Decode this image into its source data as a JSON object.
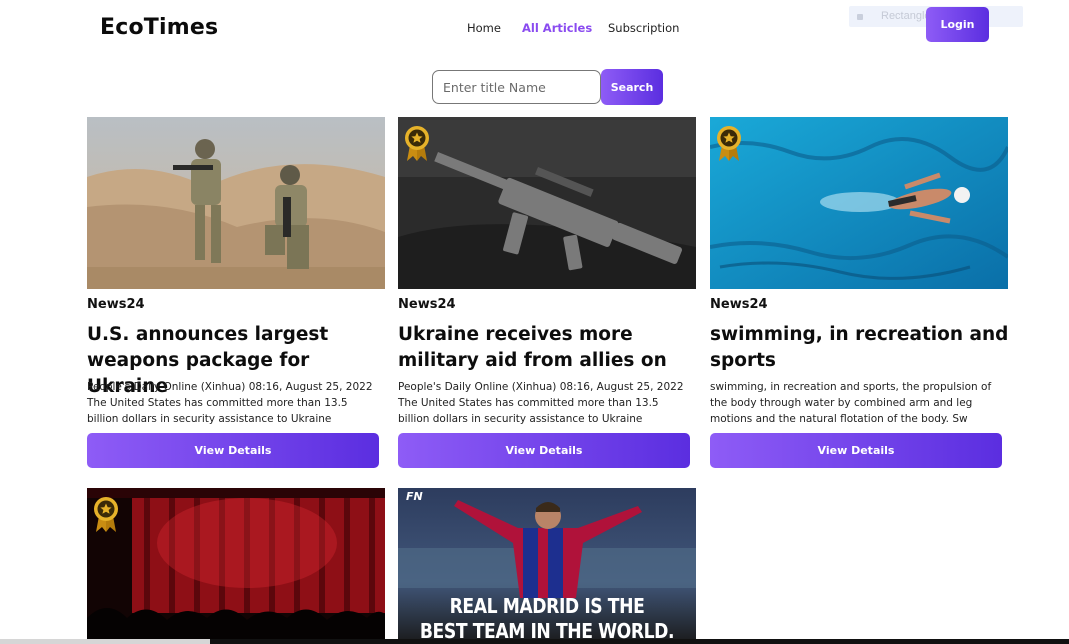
{
  "header": {
    "logo": "EcoTimes",
    "nav": [
      {
        "label": "Home",
        "active": false
      },
      {
        "label": "All Articles",
        "active": true
      },
      {
        "label": "Subscription",
        "active": false
      }
    ],
    "ghost_label": "Rectangle 1 Path",
    "login_label": "Login"
  },
  "search": {
    "placeholder": "Enter title Name",
    "value": "",
    "button_label": "Search"
  },
  "articles": [
    {
      "source": "News24",
      "title": "U.S. announces largest weapons package for Ukraine",
      "description": "People's Daily Online (Xinhua) 08:16, August 25, 2022 The United States has committed more than 13.5 billion dollars in security assistance to Ukraine",
      "button_label": "View Details",
      "premium": false,
      "image": "soldiers-photo"
    },
    {
      "source": "News24",
      "title": "Ukraine receives more military aid from allies on",
      "description": "People's Daily Online (Xinhua) 08:16, August 25, 2022 The United States has committed more than 13.5 billion dollars in security assistance to Ukraine",
      "button_label": "View Details",
      "premium": true,
      "image": "rifle-photo"
    },
    {
      "source": "News24",
      "title": "swimming, in recreation and sports",
      "description": "swimming, in recreation and sports, the propulsion of the body through water by combined arm and leg motions and the natural flotation of the body. Sw",
      "button_label": "View Details",
      "premium": true,
      "image": "swimmer-photo"
    },
    {
      "premium": true,
      "image": "theater-curtain-photo"
    },
    {
      "premium": false,
      "image": "football-poster-photo",
      "poster_logo": "FN",
      "poster_line1": "REAL MADRID IS THE",
      "poster_line2": "BEST TEAM IN THE WORLD."
    }
  ],
  "colors": {
    "accent": "#8a4bf0",
    "button_gradient_start": "#8e5cf6",
    "button_gradient_end": "#5b2ee0",
    "badge_gold": "#d9a61c"
  }
}
